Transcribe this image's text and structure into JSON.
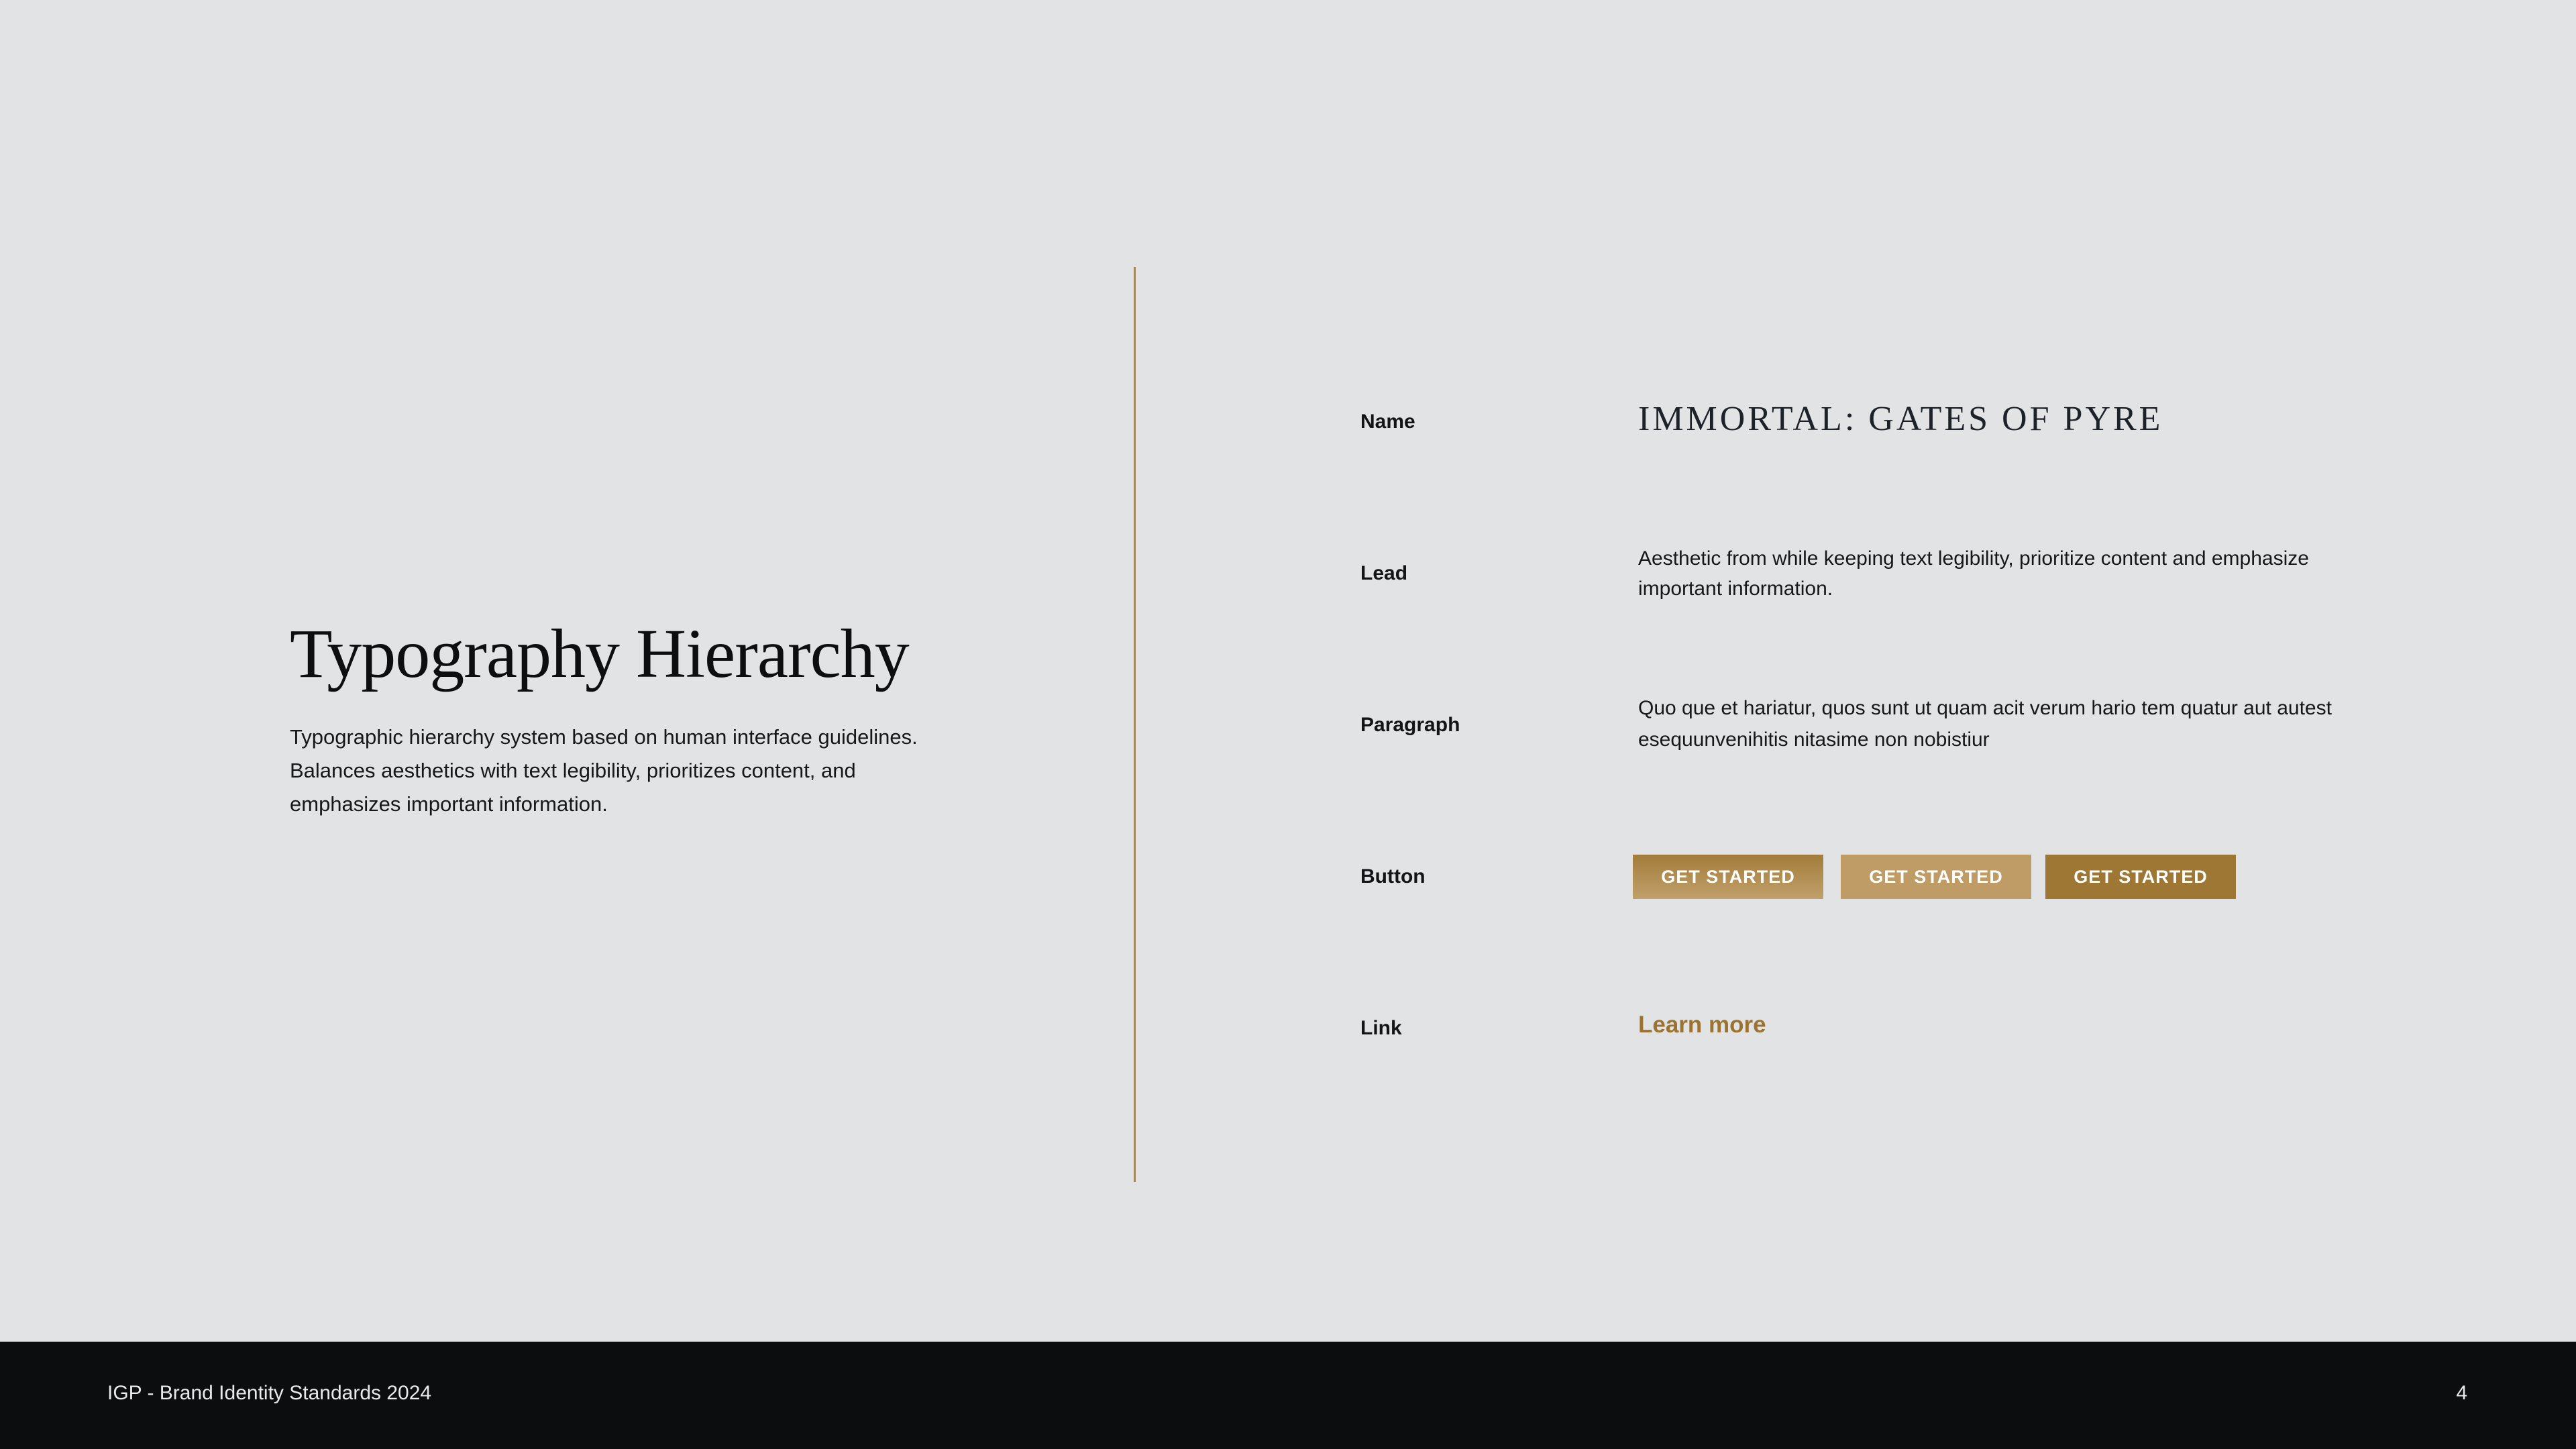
{
  "left": {
    "title": "Typography Hierarchy",
    "description": "Typographic hierarchy system based on human interface guidelines. Balances aesthetics with text legibility, prioritizes content, and emphasizes important information."
  },
  "rows": {
    "name": {
      "label": "Name",
      "value": "IMMORTAL: GATES OF PYRE"
    },
    "lead": {
      "label": "Lead",
      "value": "Aesthetic from while keeping text legibility, prioritize content and emphasize important information."
    },
    "paragraph": {
      "label": "Paragraph",
      "value": "Quo que et hariatur, quos sunt ut quam acit verum hario tem quatur aut autest esequunvenihitis nitasime non nobistiur"
    },
    "button": {
      "label": "Button",
      "buttons": [
        "GET STARTED",
        "GET STARTED",
        "GET STARTED"
      ]
    },
    "link": {
      "label": "Link",
      "value": "Learn more"
    }
  },
  "colors": {
    "accent": "#9e7734",
    "accent_light": "#bf9c66",
    "background": "#e2e3e5",
    "footer": "#0c0d0f"
  },
  "footer": {
    "text": "IGP - Brand Identity Standards 2024",
    "page_number": "4"
  }
}
